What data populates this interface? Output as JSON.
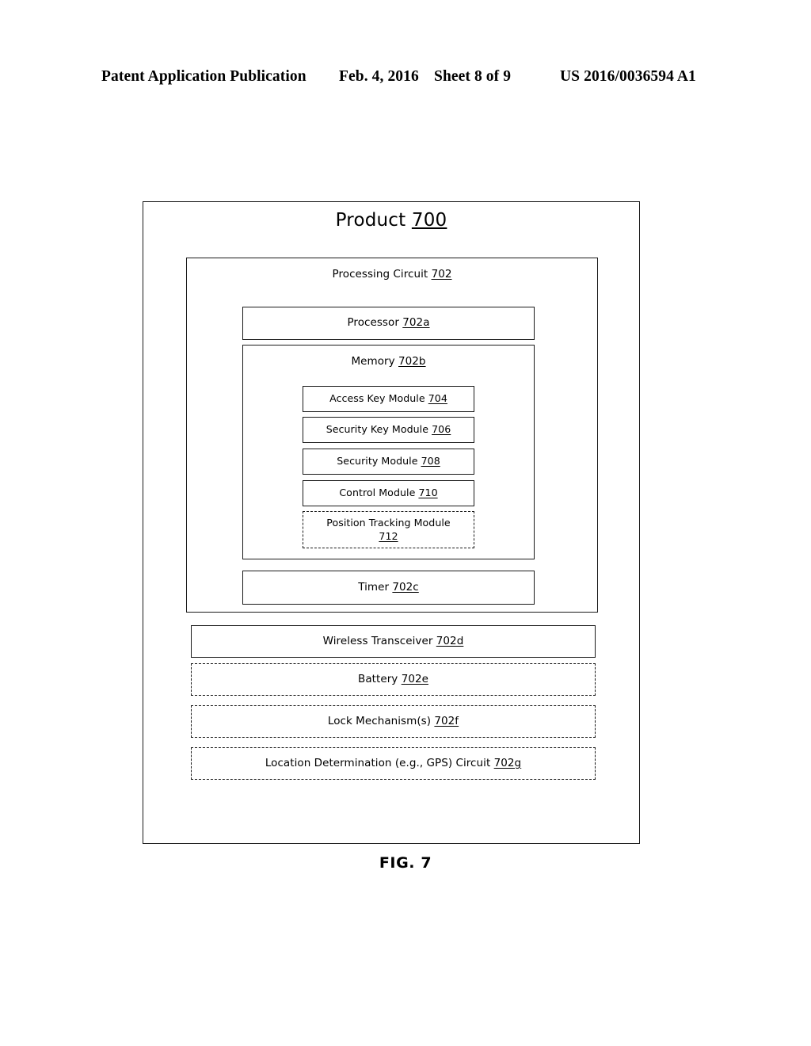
{
  "header": {
    "publication": "Patent Application Publication",
    "date": "Feb. 4, 2016",
    "sheet": "Sheet 8 of 9",
    "patent_number": "US 2016/0036594 A1"
  },
  "figure": {
    "caption": "FIG. 7",
    "product": {
      "label": "Product",
      "ref": "700",
      "processing_circuit": {
        "label": "Processing Circuit",
        "ref": "702",
        "processor": {
          "label": "Processor",
          "ref": "702a"
        },
        "memory": {
          "label": "Memory",
          "ref": "702b",
          "modules": [
            {
              "label": "Access Key Module",
              "ref": "704",
              "style": "solid"
            },
            {
              "label": "Security Key Module",
              "ref": "706",
              "style": "solid"
            },
            {
              "label": "Security Module",
              "ref": "708",
              "style": "solid"
            },
            {
              "label": "Control Module",
              "ref": "710",
              "style": "solid"
            },
            {
              "label": "Position Tracking Module",
              "ref": "712",
              "style": "dashed"
            }
          ]
        },
        "timer": {
          "label": "Timer",
          "ref": "702c"
        }
      },
      "components": [
        {
          "label": "Wireless Transceiver",
          "ref": "702d",
          "style": "solid"
        },
        {
          "label": "Battery",
          "ref": "702e",
          "style": "dashed"
        },
        {
          "label": "Lock Mechanism(s)",
          "ref": "702f",
          "style": "dashed"
        },
        {
          "label": "Location Determination (e.g., GPS) Circuit",
          "ref": "702g",
          "style": "dashed"
        }
      ]
    }
  },
  "colors": {
    "ink": "#1a1a1a",
    "page": "#ffffff"
  }
}
